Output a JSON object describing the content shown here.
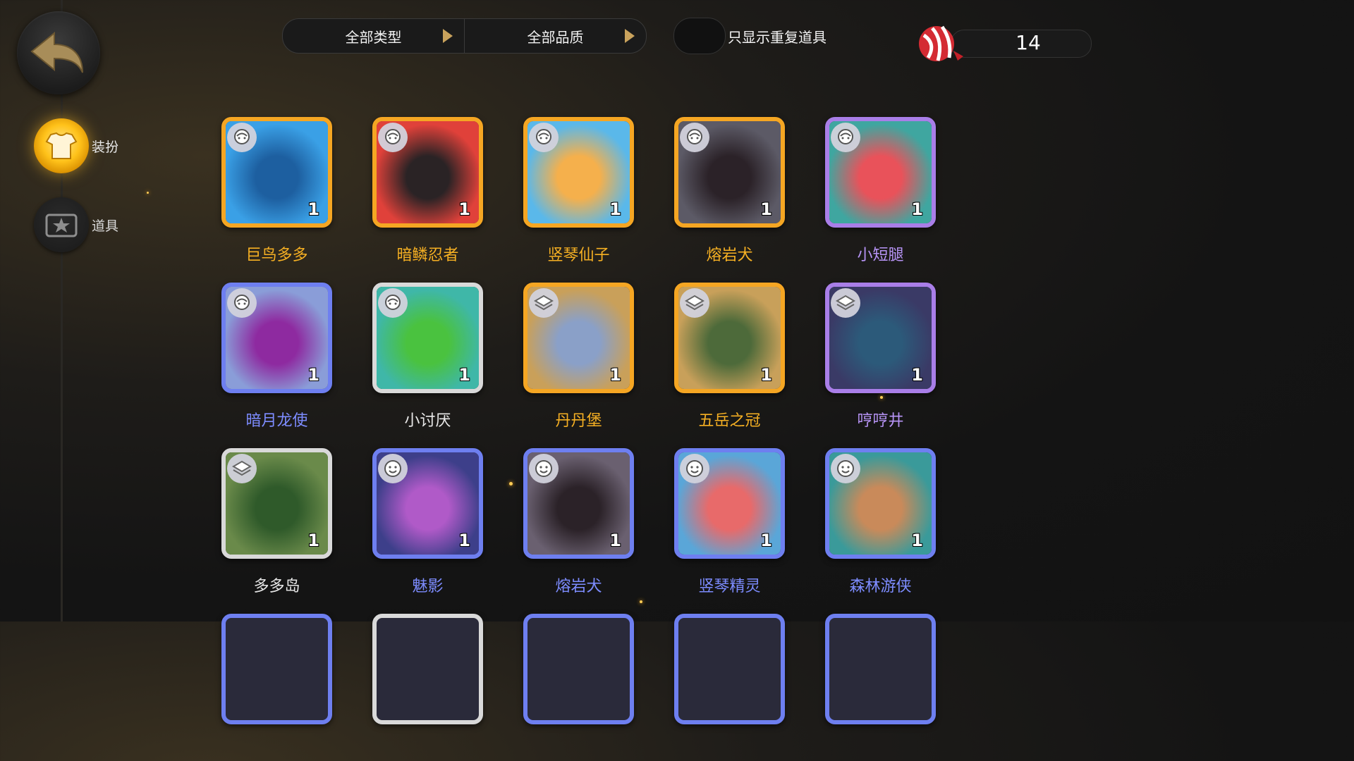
{
  "nav": {
    "items": [
      {
        "label": "装扮",
        "icon": "outfit-icon",
        "active": true
      },
      {
        "label": "道具",
        "icon": "item-icon",
        "active": false
      }
    ]
  },
  "filters": {
    "type_label": "全部类型",
    "quality_label": "全部品质"
  },
  "toggle": {
    "label": "只显示重复道具",
    "on": false
  },
  "currency": {
    "icon": "candy-icon",
    "value": "14"
  },
  "items": [
    {
      "name": "巨鸟多多",
      "count": "1",
      "quality": "gold",
      "badge": "avatar-icon",
      "colors": [
        "#3aa0e6",
        "#1d5fa0"
      ]
    },
    {
      "name": "暗鳞忍者",
      "count": "1",
      "quality": "gold",
      "badge": "avatar-icon",
      "colors": [
        "#e0413a",
        "#2a2325"
      ]
    },
    {
      "name": "竖琴仙子",
      "count": "1",
      "quality": "gold",
      "badge": "avatar-icon",
      "colors": [
        "#5ab8ea",
        "#f5b04c"
      ]
    },
    {
      "name": "熔岩犬",
      "count": "1",
      "quality": "gold",
      "badge": "avatar-icon",
      "colors": [
        "#5c5a66",
        "#2b2228"
      ]
    },
    {
      "name": "小短腿",
      "count": "1",
      "quality": "purple",
      "badge": "avatar-icon",
      "colors": [
        "#3fa6a0",
        "#e9525a"
      ]
    },
    {
      "name": "暗月龙使",
      "count": "1",
      "quality": "blue",
      "badge": "avatar-icon",
      "colors": [
        "#8a9dd8",
        "#8e2aa0"
      ]
    },
    {
      "name": "小讨厌",
      "count": "1",
      "quality": "white",
      "badge": "avatar-icon",
      "colors": [
        "#3fb7a8",
        "#4ac23f"
      ]
    },
    {
      "name": "丹丹堡",
      "count": "1",
      "quality": "gold",
      "badge": "board-icon",
      "colors": [
        "#c9a05a",
        "#8aa0c8"
      ]
    },
    {
      "name": "五岳之冠",
      "count": "1",
      "quality": "gold",
      "badge": "board-icon",
      "colors": [
        "#c8a05a",
        "#4d6a3a"
      ]
    },
    {
      "name": "哼哼井",
      "count": "1",
      "quality": "purple",
      "badge": "board-icon",
      "colors": [
        "#3a3a66",
        "#2c5a7a"
      ]
    },
    {
      "name": "多多岛",
      "count": "1",
      "quality": "white",
      "badge": "board-icon",
      "colors": [
        "#6a8a4a",
        "#2f5a2a"
      ]
    },
    {
      "name": "魅影",
      "count": "1",
      "quality": "blue",
      "badge": "emote-icon",
      "colors": [
        "#3d3f8a",
        "#b05ac8"
      ]
    },
    {
      "name": "熔岩犬",
      "count": "1",
      "quality": "blue",
      "badge": "emote-icon",
      "colors": [
        "#6a6070",
        "#2b2228"
      ]
    },
    {
      "name": "竖琴精灵",
      "count": "1",
      "quality": "blue",
      "badge": "emote-icon",
      "colors": [
        "#5aa6d8",
        "#e86a6a"
      ]
    },
    {
      "name": "森林游侠",
      "count": "1",
      "quality": "blue",
      "badge": "emote-icon",
      "colors": [
        "#3a9a9a",
        "#c98a5a"
      ]
    }
  ]
}
